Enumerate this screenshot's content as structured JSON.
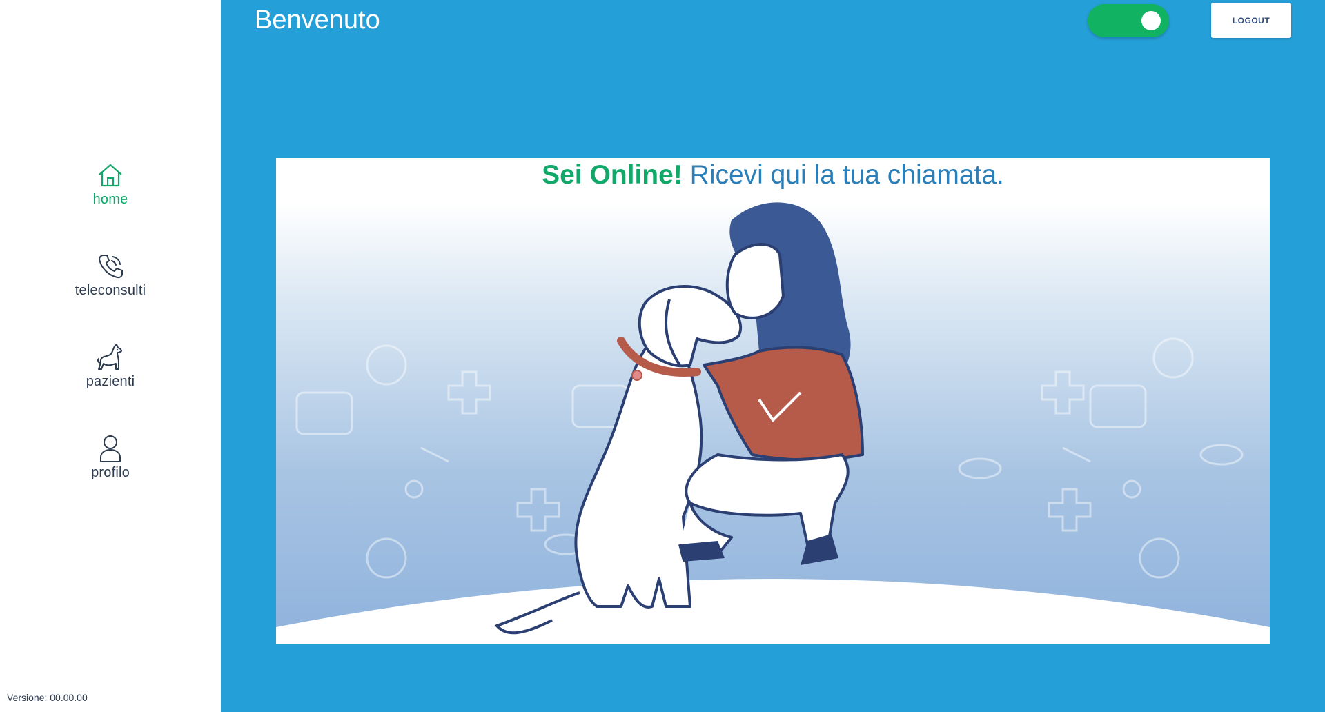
{
  "sidebar": {
    "items": [
      {
        "label": "home",
        "icon": "home-icon",
        "active": true
      },
      {
        "label": "teleconsulti",
        "icon": "phone-icon",
        "active": false
      },
      {
        "label": "pazienti",
        "icon": "dog-icon",
        "active": false
      },
      {
        "label": "profilo",
        "icon": "user-icon",
        "active": false
      }
    ],
    "version": "Versione: 00.00.00"
  },
  "header": {
    "title": "Benvenuto",
    "status_toggle": {
      "on": true,
      "color": "#12b263"
    },
    "logout_label": "LOGOUT"
  },
  "card": {
    "title_strong": "Sei Online!",
    "title_rest": " Ricevi qui la tua chiamata.",
    "illustration": "woman-hugging-dog-illustration"
  },
  "colors": {
    "accent": "#12a86a",
    "main_bg": "#259fd8",
    "text_dark": "#2d3b4f"
  }
}
